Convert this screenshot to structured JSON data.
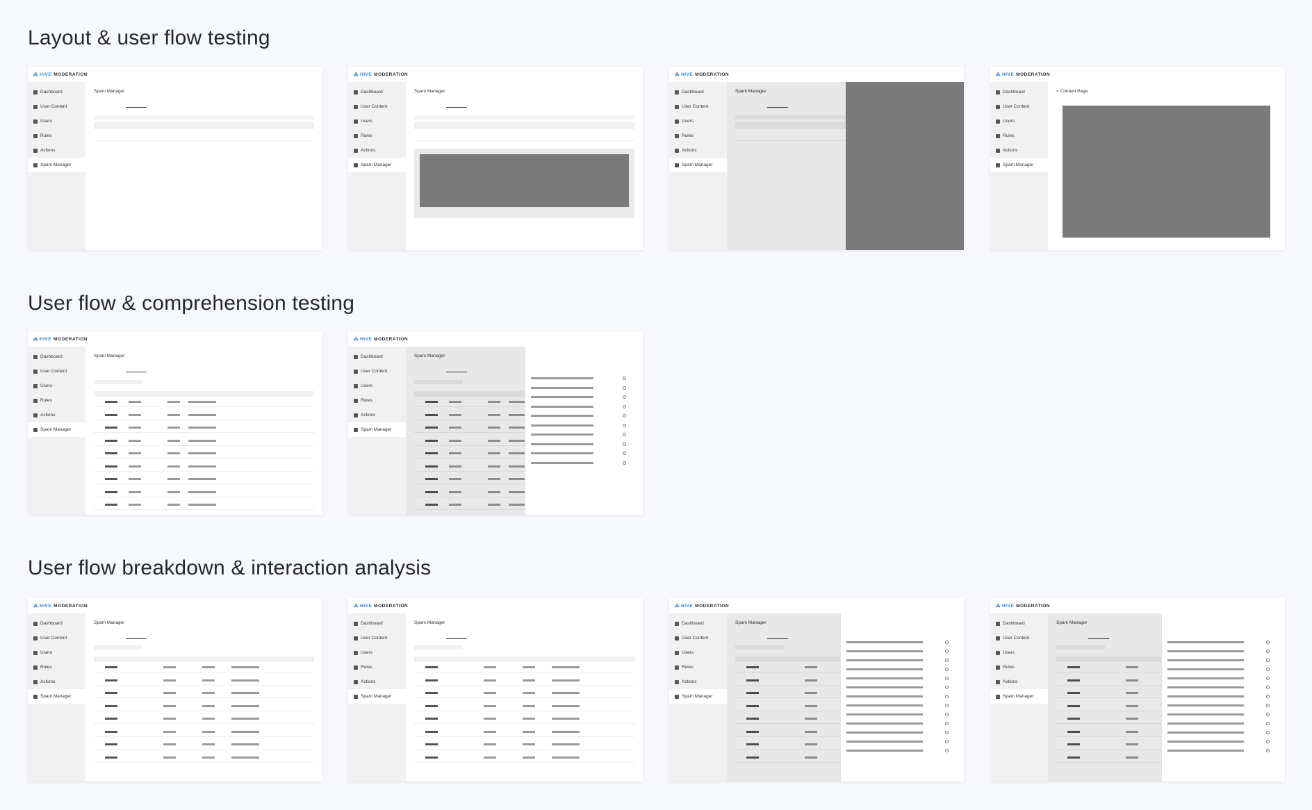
{
  "sections": [
    {
      "title": "Layout & user flow testing"
    },
    {
      "title": "User flow & comprehension testing"
    },
    {
      "title": "User flow breakdown & interaction analysis"
    }
  ],
  "app": {
    "logo_brand": "HIVE",
    "logo_product": "MODERATION",
    "nav": [
      "Dashboard",
      "User Content",
      "Users",
      "Rules",
      "Actions",
      "Spam Manager"
    ],
    "main_title": "Spam Manager",
    "back_link": "< Content Page"
  },
  "colors": {
    "accent": "#2f7fd6",
    "sidebar_bg": "#f1f1f1",
    "placeholder_block": "#7a7a7a"
  }
}
